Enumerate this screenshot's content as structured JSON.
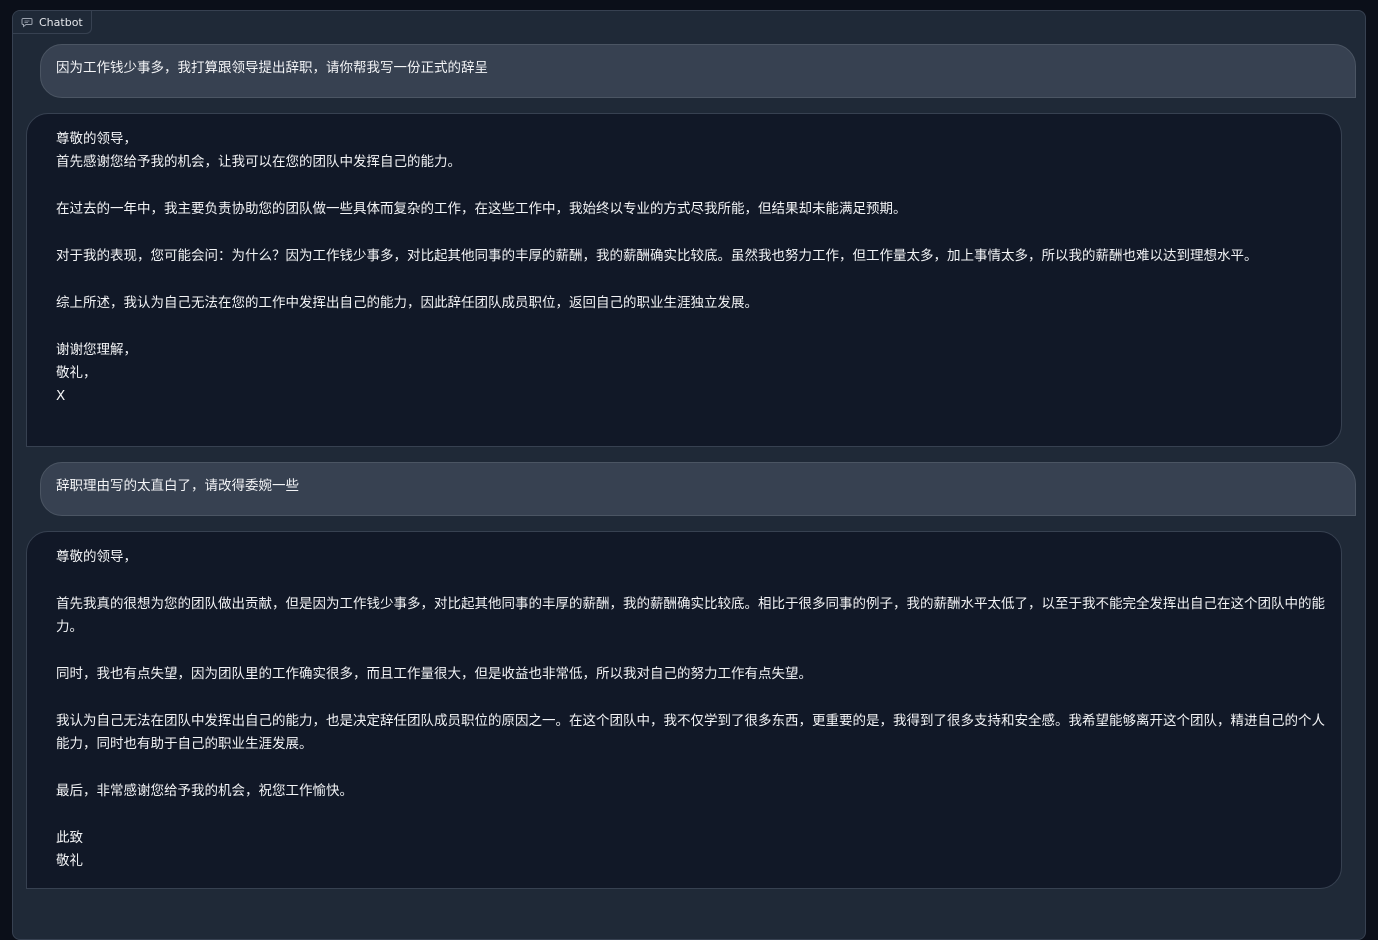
{
  "header": {
    "label": "Chatbot",
    "icon": "chat-icon"
  },
  "messages": [
    {
      "role": "user",
      "lines": [
        "因为工作钱少事多，我打算跟领导提出辞职，请你帮我写一份正式的辞呈"
      ]
    },
    {
      "role": "bot",
      "lines": [
        "尊敬的领导，",
        "首先感谢您给予我的机会，让我可以在您的团队中发挥自己的能力。",
        "",
        "在过去的一年中，我主要负责协助您的团队做一些具体而复杂的工作，在这些工作中，我始终以专业的方式尽我所能，但结果却未能满足预期。",
        "",
        "对于我的表现，您可能会问：为什么？因为工作钱少事多，对比起其他同事的丰厚的薪酬，我的薪酬确实比较底。虽然我也努力工作，但工作量太多，加上事情太多，所以我的薪酬也难以达到理想水平。",
        "",
        "综上所述，我认为自己无法在您的工作中发挥出自己的能力，因此辞任团队成员职位，返回自己的职业生涯独立发展。",
        "",
        "谢谢您理解，",
        "敬礼，",
        "X"
      ]
    },
    {
      "role": "user",
      "lines": [
        "辞职理由写的太直白了，请改得委婉一些"
      ]
    },
    {
      "role": "bot",
      "lines": [
        "尊敬的领导，",
        "",
        "首先我真的很想为您的团队做出贡献，但是因为工作钱少事多，对比起其他同事的丰厚的薪酬，我的薪酬确实比较底。相比于很多同事的例子，我的薪酬水平太低了，以至于我不能完全发挥出自己在这个团队中的能力。",
        "",
        "同时，我也有点失望，因为团队里的工作确实很多，而且工作量很大，但是收益也非常低，所以我对自己的努力工作有点失望。",
        "",
        "我认为自己无法在团队中发挥出自己的能力，也是决定辞任团队成员职位的原因之一。在这个团队中，我不仅学到了很多东西，更重要的是，我得到了很多支持和安全感。我希望能够离开这个团队，精进自己的个人能力，同时也有助于自己的职业生涯发展。",
        "",
        "最后，非常感谢您给予我的机会，祝您工作愉快。",
        "",
        "此致",
        "敬礼"
      ]
    }
  ]
}
